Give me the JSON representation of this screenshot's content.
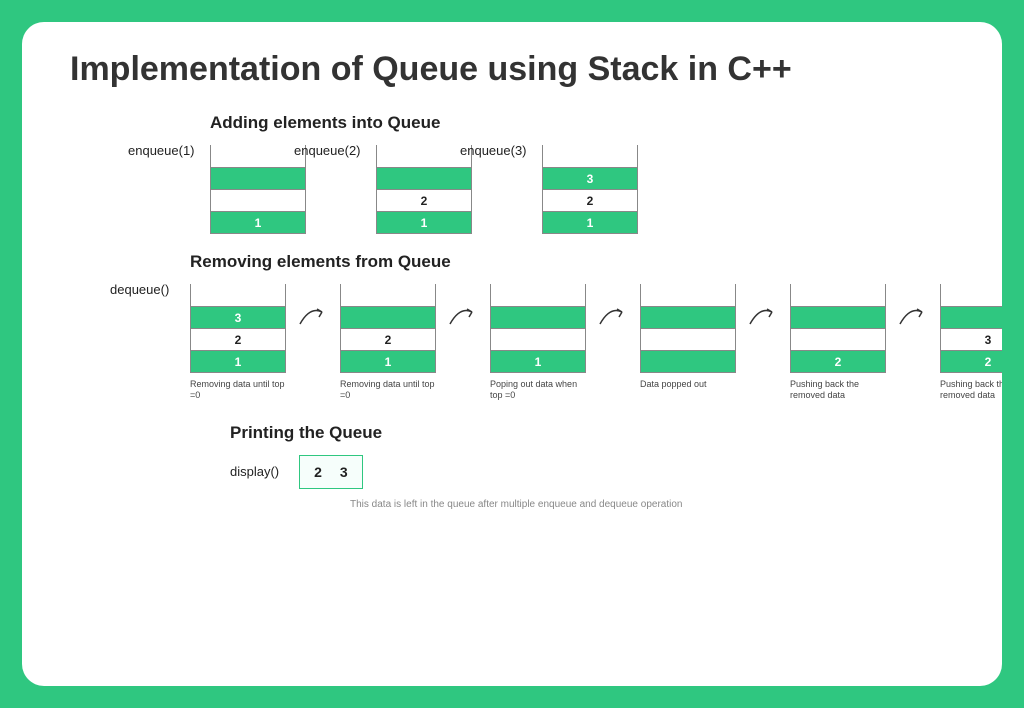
{
  "title": "Implementation of Queue using Stack in C++",
  "adding": {
    "heading": "Adding elements into Queue",
    "stacks": [
      {
        "label": "enqueue(1)",
        "cells": [
          {
            "text": "",
            "cls": "white open-top"
          },
          {
            "text": "",
            "cls": "green"
          },
          {
            "text": "",
            "cls": "white"
          },
          {
            "text": "1",
            "cls": "green"
          }
        ]
      },
      {
        "label": "enqueue(2)",
        "cells": [
          {
            "text": "",
            "cls": "white open-top"
          },
          {
            "text": "",
            "cls": "green"
          },
          {
            "text": "2",
            "cls": "white"
          },
          {
            "text": "1",
            "cls": "green"
          }
        ]
      },
      {
        "label": "enqueue(3)",
        "cells": [
          {
            "text": "",
            "cls": "white open-top"
          },
          {
            "text": "3",
            "cls": "green"
          },
          {
            "text": "2",
            "cls": "white"
          },
          {
            "text": "1",
            "cls": "green"
          }
        ]
      }
    ]
  },
  "removing": {
    "heading": "Removing elements from Queue",
    "label": "dequeue()",
    "stacks": [
      {
        "caption": "Removing data until top =0",
        "cells": [
          {
            "text": "",
            "cls": "white open-top"
          },
          {
            "text": "3",
            "cls": "green"
          },
          {
            "text": "2",
            "cls": "white"
          },
          {
            "text": "1",
            "cls": "green"
          }
        ]
      },
      {
        "caption": "Removing data until top =0",
        "cells": [
          {
            "text": "",
            "cls": "white open-top"
          },
          {
            "text": "",
            "cls": "green"
          },
          {
            "text": "2",
            "cls": "white"
          },
          {
            "text": "1",
            "cls": "green"
          }
        ]
      },
      {
        "caption": "Poping out data when top =0",
        "cells": [
          {
            "text": "",
            "cls": "white open-top"
          },
          {
            "text": "",
            "cls": "green"
          },
          {
            "text": "",
            "cls": "white"
          },
          {
            "text": "1",
            "cls": "green"
          }
        ]
      },
      {
        "caption": "Data popped out",
        "cells": [
          {
            "text": "",
            "cls": "white open-top"
          },
          {
            "text": "",
            "cls": "green"
          },
          {
            "text": "",
            "cls": "white"
          },
          {
            "text": "",
            "cls": "green"
          }
        ]
      },
      {
        "caption": "Pushing back the removed data",
        "cells": [
          {
            "text": "",
            "cls": "white open-top"
          },
          {
            "text": "",
            "cls": "green"
          },
          {
            "text": "",
            "cls": "white"
          },
          {
            "text": "2",
            "cls": "green"
          }
        ]
      },
      {
        "caption": "Pushing back the removed data",
        "cells": [
          {
            "text": "",
            "cls": "white open-top"
          },
          {
            "text": "",
            "cls": "green"
          },
          {
            "text": "3",
            "cls": "white"
          },
          {
            "text": "2",
            "cls": "green"
          }
        ]
      }
    ]
  },
  "printing": {
    "heading": "Printing the Queue",
    "label": "display()",
    "values": [
      "2",
      "3"
    ],
    "note": "This data is left in the queue after multiple enqueue and dequeue operation"
  }
}
